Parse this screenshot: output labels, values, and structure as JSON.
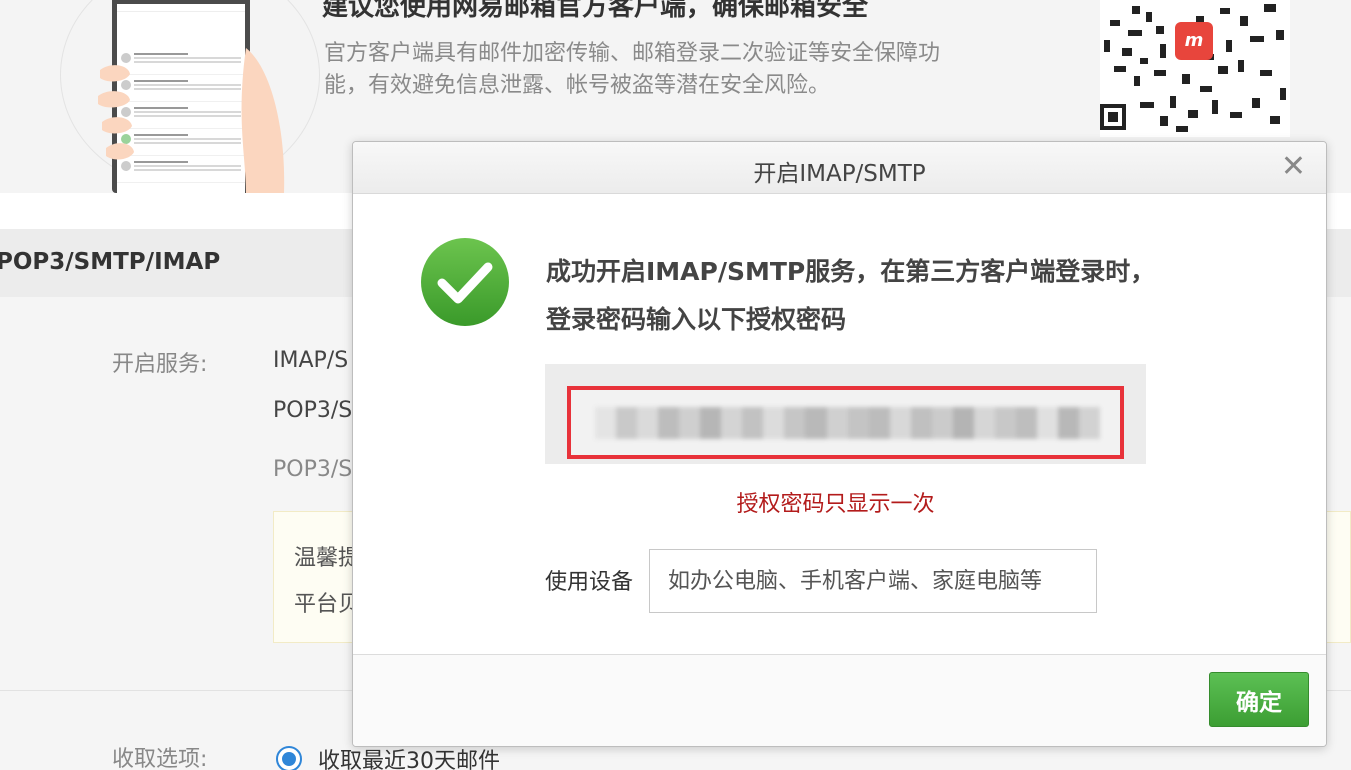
{
  "promo": {
    "title": "建议您使用网易邮箱官方客户端，确保邮箱安全",
    "description": "官方客户端具有邮件加密传输、邮箱登录二次验证等安全保障功能，有效避免信息泄露、帐号被盗等潜在安全风险。"
  },
  "settings": {
    "section_title": "POP3/SMTP/IMAP",
    "open_service_label": "开启服务:",
    "service_1": "IMAP/S",
    "service_2": "POP3/S",
    "service_3": "POP3/S",
    "tip_line_1": "温馨提",
    "tip_line_2": "平台贝",
    "fetch_label": "收取选项:",
    "fetch_option": "收取最近30天邮件"
  },
  "dialog": {
    "title": "开启IMAP/SMTP",
    "close_glyph": "✕",
    "success_message": "成功开启IMAP/SMTP服务，在第三方客户端登录时，登录密码输入以下授权密码",
    "once_note": "授权密码只显示一次",
    "device_label": "使用设备",
    "device_placeholder": "如办公电脑、手机客户端、家庭电脑等",
    "ok_label": "确定"
  },
  "colors": {
    "accent_green": "#3c9e33",
    "alert_red": "#e8323a",
    "note_red": "#b31b1b",
    "radio_blue": "#2f86d8"
  }
}
